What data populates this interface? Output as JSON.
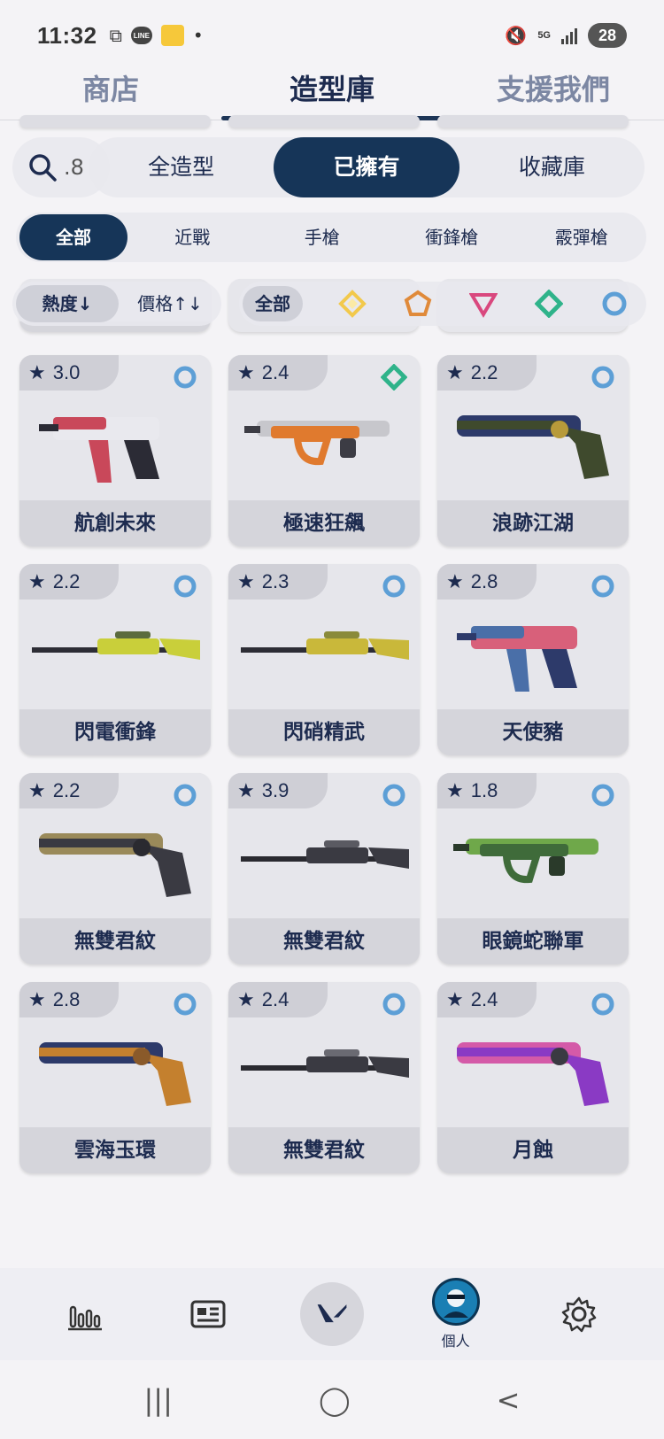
{
  "status_bar": {
    "time": "11:32",
    "network": "5G",
    "battery": "28",
    "line_label": "LINE"
  },
  "top_tabs": [
    {
      "label": "商店",
      "active": false
    },
    {
      "label": "造型庫",
      "active": true
    },
    {
      "label": "支援我們",
      "active": false
    }
  ],
  "search": {
    "peek_text": ".8"
  },
  "segments": [
    {
      "label": "全造型",
      "active": false
    },
    {
      "label": "已擁有",
      "active": true
    },
    {
      "label": "收藏庫",
      "active": false
    }
  ],
  "categories": [
    {
      "label": "全部",
      "active": true
    },
    {
      "label": "近戰",
      "active": false
    },
    {
      "label": "手槍",
      "active": false
    },
    {
      "label": "衝鋒槍",
      "active": false
    },
    {
      "label": "霰彈槍",
      "active": false
    }
  ],
  "sorts": [
    {
      "label": "熱度↓",
      "active": true
    },
    {
      "label": "價格↑↓",
      "active": false
    }
  ],
  "tier_filter": {
    "all_label": "全部",
    "tiers": [
      {
        "icon": "yellow-diamond-icon",
        "color": "#f2c94c"
      },
      {
        "icon": "orange-pentagon-icon",
        "color": "#e08a3a"
      },
      {
        "icon": "pink-triangle-icon",
        "color": "#d9487e"
      },
      {
        "icon": "green-diamond-icon",
        "color": "#2fb38a"
      },
      {
        "icon": "blue-circle-icon",
        "color": "#5d9fd6"
      }
    ]
  },
  "skins": [
    {
      "rating": "3.0",
      "name": "航創未來",
      "tier": "blue-circle-icon",
      "colors": [
        "#c9485a",
        "#e9e9ee",
        "#2b2b35"
      ]
    },
    {
      "rating": "2.4",
      "name": "極速狂飆",
      "tier": "green-diamond-icon",
      "colors": [
        "#e07a2e",
        "#c7c7cc",
        "#3c3c44"
      ]
    },
    {
      "rating": "2.2",
      "name": "浪跡江湖",
      "tier": "blue-circle-icon",
      "colors": [
        "#3f4a2d",
        "#2d3a6a",
        "#b79a3a"
      ]
    },
    {
      "rating": "2.2",
      "name": "閃電衝鋒",
      "tier": "blue-circle-icon",
      "colors": [
        "#c9cf3a",
        "#5b6b3e",
        "#2d2d35"
      ]
    },
    {
      "rating": "2.3",
      "name": "閃硝精武",
      "tier": "blue-circle-icon",
      "colors": [
        "#c9b83a",
        "#8a8a3a",
        "#2d2d35"
      ]
    },
    {
      "rating": "2.8",
      "name": "天使豬",
      "tier": "blue-circle-icon",
      "colors": [
        "#4a6fa8",
        "#d8607a",
        "#2d3a6a"
      ]
    },
    {
      "rating": "2.2",
      "name": "無雙君紋",
      "tier": "blue-circle-icon",
      "colors": [
        "#3a3a42",
        "#9a8a5a",
        "#2a2a30"
      ]
    },
    {
      "rating": "3.9",
      "name": "無雙君紋",
      "tier": "blue-circle-icon",
      "colors": [
        "#3a3a42",
        "#5a5a62",
        "#2a2a30"
      ]
    },
    {
      "rating": "1.8",
      "name": "眼鏡蛇聯軍",
      "tier": "blue-circle-icon",
      "colors": [
        "#3f6b3a",
        "#6fa84a",
        "#2a3a2a"
      ]
    },
    {
      "rating": "2.8",
      "name": "雲海玉環",
      "tier": "blue-circle-icon",
      "colors": [
        "#c4802e",
        "#2d3a6a",
        "#8a5a2a"
      ]
    },
    {
      "rating": "2.4",
      "name": "無雙君紋",
      "tier": "blue-circle-icon",
      "colors": [
        "#3a3a42",
        "#6a6a72",
        "#2a2a30"
      ]
    },
    {
      "rating": "2.4",
      "name": "月蝕",
      "tier": "blue-circle-icon",
      "colors": [
        "#8a3ac4",
        "#d45aa8",
        "#3a3a42"
      ]
    }
  ],
  "bottom_nav": [
    {
      "icon": "stats-chart-icon",
      "label": ""
    },
    {
      "icon": "news-icon",
      "label": ""
    },
    {
      "icon": "valorant-logo-icon",
      "label": ""
    },
    {
      "icon": "avatar-icon",
      "label": "個人"
    },
    {
      "icon": "gear-icon",
      "label": ""
    }
  ],
  "accent_color": "#163558"
}
